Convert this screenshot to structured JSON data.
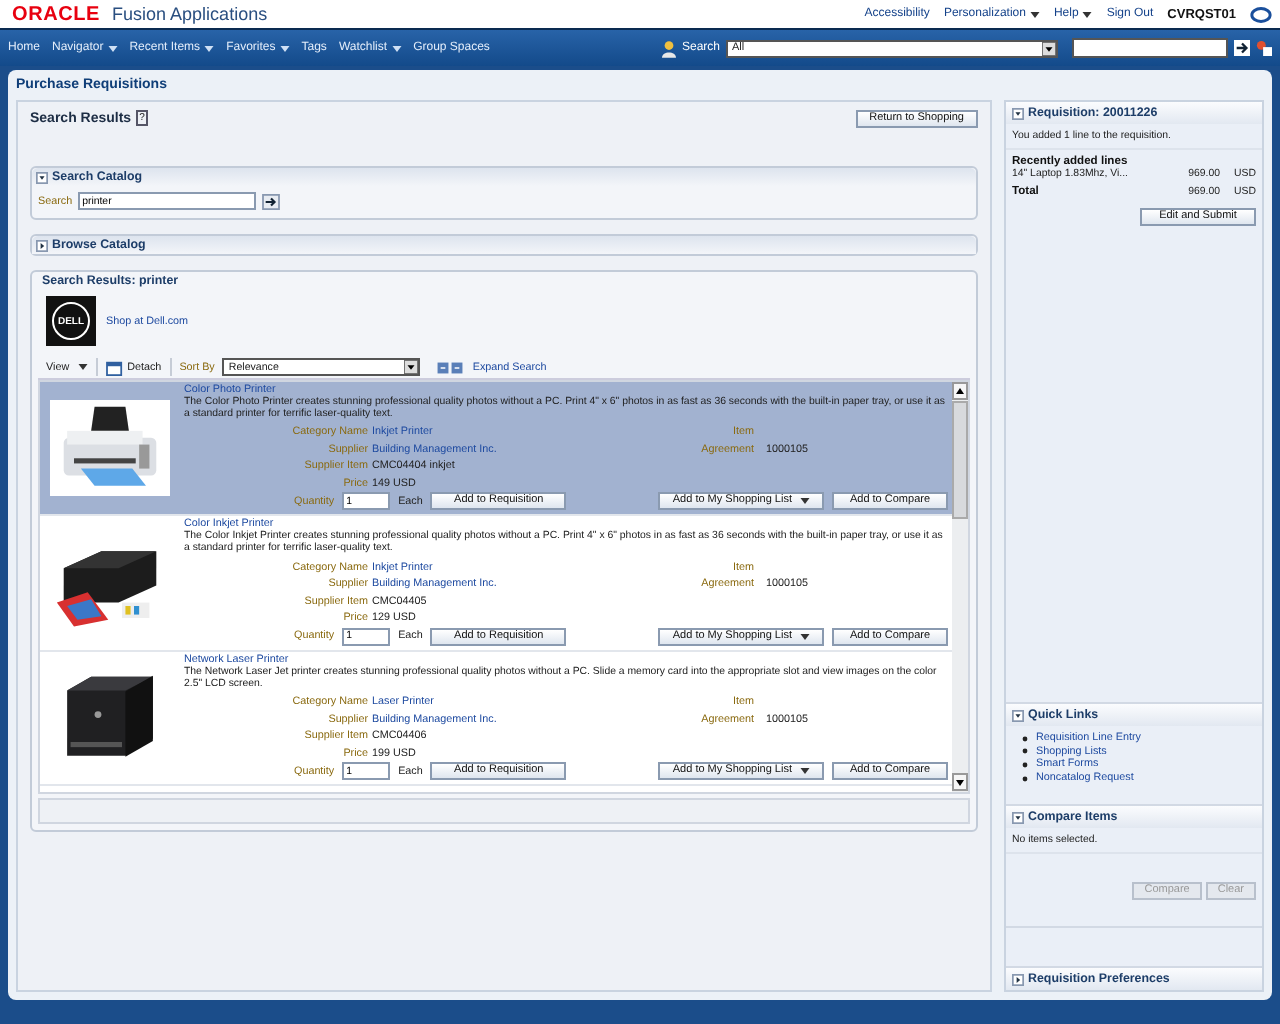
{
  "header": {
    "brand": "ORACLE",
    "product": "Fusion Applications",
    "links": [
      {
        "label": "Accessibility",
        "menu": false
      },
      {
        "label": "Personalization",
        "menu": true
      },
      {
        "label": "Help",
        "menu": true
      },
      {
        "label": "Sign Out",
        "menu": false
      }
    ],
    "user": "CVRQST01"
  },
  "nav": {
    "items": [
      {
        "label": "Home",
        "menu": false
      },
      {
        "label": "Navigator",
        "menu": true
      },
      {
        "label": "Recent Items",
        "menu": true
      },
      {
        "label": "Favorites",
        "menu": true
      },
      {
        "label": "Tags",
        "menu": false
      },
      {
        "label": "Watchlist",
        "menu": true
      },
      {
        "label": "Group Spaces",
        "menu": false
      }
    ],
    "search_label": "Search",
    "search_scope": "All"
  },
  "page_title": "Purchase Requisitions",
  "search_results": {
    "title": "Search Results",
    "help": "?",
    "return_button": "Return to Shopping"
  },
  "search_catalog": {
    "title": "Search Catalog",
    "expanded": true,
    "label": "Search",
    "value": "printer"
  },
  "browse_catalog": {
    "title": "Browse Catalog",
    "expanded": false
  },
  "results": {
    "title": "Search Results: printer",
    "logo": "DELL",
    "supplier_link": "Shop at Dell.com",
    "toolbar": {
      "view": "View",
      "detach": "Detach",
      "sort_label": "Sort By",
      "sort_value": "Relevance",
      "expand": "Expand Search"
    },
    "items": [
      {
        "selected": true,
        "name": "Color Photo Printer",
        "description": "The Color Photo Printer creates stunning professional quality photos without a PC. Print 4\" x 6\" photos in as fast as 36 seconds with the built-in paper tray, or use it as a standard printer for terrific laser-quality text.",
        "category_label": "Category Name",
        "category": "Inkjet Printer",
        "supplier_label": "Supplier",
        "supplier": "Building Management Inc.",
        "supplier_item_label": "Supplier Item",
        "supplier_item": "CMC04404 inkjet",
        "price_label": "Price",
        "price": "149 USD",
        "item_label": "Item",
        "agreement_label": "Agreement",
        "agreement": "1000105",
        "quantity_label": "Quantity",
        "quantity": "1",
        "unit": "Each",
        "add_button": "Add to Requisition",
        "list_button": "Add to My Shopping List",
        "compare_button": "Add to Compare"
      },
      {
        "kind": "inkjet",
        "selected": false,
        "name": "Color Inkjet Printer",
        "description": "The Color Inkjet Printer creates stunning professional quality photos without a PC. Print 4\" x 6\" photos in as fast as 36 seconds with the built-in paper tray, or use it as a standard printer for terrific laser-quality text.",
        "category_label": "Category Name",
        "category": "Inkjet Printer",
        "supplier_label": "Supplier",
        "supplier": "Building Management Inc.",
        "supplier_item_label": "Supplier Item",
        "supplier_item": "CMC04405",
        "price_label": "Price",
        "price": "129 USD",
        "item_label": "Item",
        "agreement_label": "Agreement",
        "agreement": "1000105",
        "quantity_label": "Quantity",
        "quantity": "1",
        "unit": "Each",
        "add_button": "Add to Requisition",
        "list_button": "Add to My Shopping List",
        "compare_button": "Add to Compare"
      },
      {
        "kind": "laser",
        "selected": false,
        "name": "Network Laser Printer",
        "description": "The Network Laser Jet printer creates stunning professional quality photos without a PC. Slide a memory card into the appropriate slot and view images on the color 2.5\" LCD screen.",
        "category_label": "Category Name",
        "category": "Laser Printer",
        "supplier_label": "Supplier",
        "supplier": "Building Management Inc.",
        "supplier_item_label": "Supplier Item",
        "supplier_item": "CMC04406",
        "price_label": "Price",
        "price": "199 USD",
        "item_label": "Item",
        "agreement_label": "Agreement",
        "agreement": "1000105",
        "quantity_label": "Quantity",
        "quantity": "1",
        "unit": "Each",
        "add_button": "Add to Requisition",
        "list_button": "Add to My Shopping List",
        "compare_button": "Add to Compare"
      }
    ]
  },
  "requisition": {
    "title": "Requisition: 20011226",
    "expanded": true,
    "message": "You added 1 line to the requisition.",
    "recent_heading": "Recently added lines",
    "lines": [
      {
        "name": "14\" Laptop 1.83Mhz, Vi...",
        "amount": "969.00",
        "currency": "USD"
      }
    ],
    "total_label": "Total",
    "total_amount": "969.00",
    "total_currency": "USD",
    "button": "Edit and Submit"
  },
  "quick_links": {
    "title": "Quick Links",
    "expanded": true,
    "links": [
      "Requisition Line Entry",
      "Shopping Lists",
      "Smart Forms",
      "Noncatalog Request"
    ]
  },
  "compare_items": {
    "title": "Compare Items",
    "expanded": true,
    "message": "No items selected.",
    "buttons": [
      {
        "label": "Compare",
        "disabled": true
      },
      {
        "label": "Clear",
        "disabled": true
      }
    ]
  },
  "preferences": {
    "title": "Requisition Preferences",
    "expanded": false
  }
}
